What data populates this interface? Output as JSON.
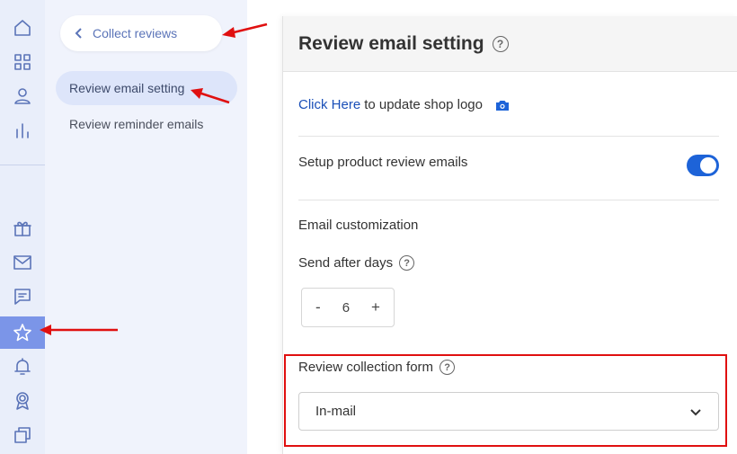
{
  "rail": {
    "top_icons": [
      "home-icon",
      "grid-icon",
      "user-icon",
      "bar-chart-icon"
    ],
    "bottom_icons": [
      "gift-icon",
      "mail-icon",
      "chat-icon",
      "star-icon",
      "bell-icon",
      "award-icon",
      "copy-icon"
    ],
    "active_icon": "star-icon"
  },
  "subnav": {
    "back_label": "Collect reviews",
    "items": [
      {
        "label": "Review email setting",
        "active": true
      },
      {
        "label": "Review reminder emails",
        "active": false
      }
    ]
  },
  "panel": {
    "title": "Review email setting",
    "logo_link": "Click Here",
    "logo_text": "to update shop logo",
    "setup_label": "Setup product review emails",
    "setup_enabled": true,
    "email_customization": "Email customization",
    "send_after_label": "Send after days",
    "stepper": {
      "minus": "-",
      "value": "6",
      "plus": "+"
    },
    "form_label": "Review collection form",
    "form_value": "In-mail"
  },
  "colors": {
    "accent": "#1d63d8",
    "annotation": "#e01010",
    "rail_bg": "#e9eefa",
    "active_icon_bg": "#7b95e8"
  }
}
